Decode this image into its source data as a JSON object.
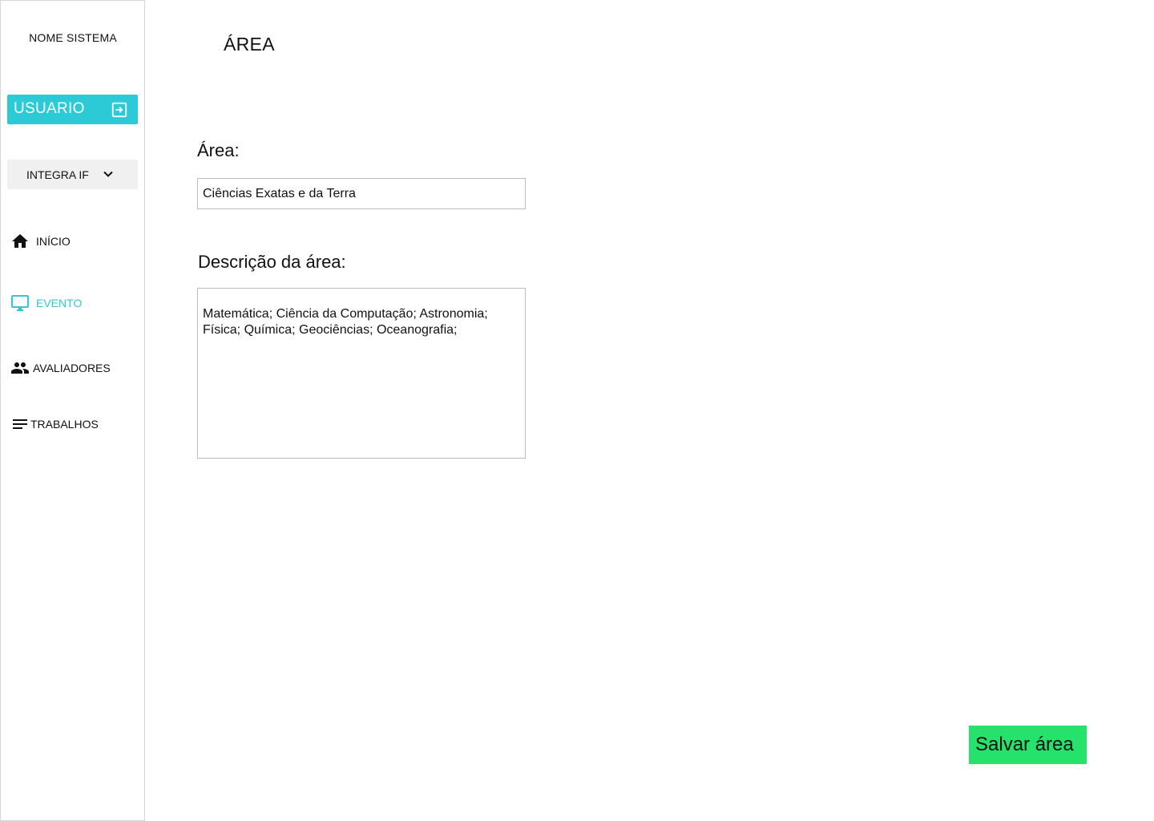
{
  "sidebar": {
    "system_name": "NOME SISTEMA",
    "user_button": {
      "label": "USUARIO",
      "icon": "logout-icon"
    },
    "event_select": {
      "value": "INTEGRA IF",
      "icon": "chevron-down-icon"
    },
    "nav_items": [
      {
        "label": "INÍCIO",
        "icon": "home-icon",
        "active": false
      },
      {
        "label": "EVENTO",
        "icon": "monitor-icon",
        "active": true
      },
      {
        "label": "AVALIADORES",
        "icon": "people-icon",
        "active": false
      },
      {
        "label": "TRABALHOS",
        "icon": "list-icon",
        "active": false
      }
    ]
  },
  "main": {
    "title": "ÁREA",
    "area_field": {
      "label": "Área:",
      "value": "Ciências Exatas e da Terra"
    },
    "description_field": {
      "label": "Descrição da área:",
      "value": "Matemática; Ciência da Computação; Astronomia; Física; Química; Geociências; Oceanografia;"
    },
    "save_button": {
      "label": "Salvar área"
    }
  },
  "colors": {
    "accent": "#2ccad7",
    "save_button": "#24e26a",
    "select_background": "#f0f0f0",
    "border": "#bdbdbd"
  }
}
